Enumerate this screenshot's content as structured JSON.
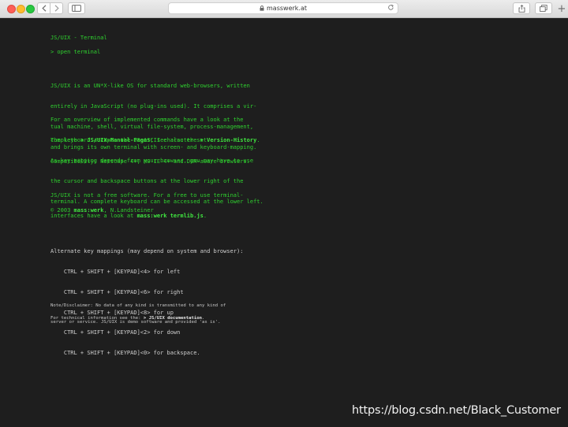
{
  "browser": {
    "url": "masswerk.at",
    "colors": {
      "red": "#fd5f57",
      "yellow": "#febc2e",
      "green": "#28c840"
    },
    "icons": [
      "back-arrow-icon",
      "forward-arrow-icon",
      "sidebar-icon",
      "lock-icon",
      "reload-icon",
      "share-icon",
      "tabs-icon",
      "plus-icon"
    ]
  },
  "terminal": {
    "text_color": "#2fd12f",
    "title": "JS/UIX - Terminal",
    "prompt": "> open terminal",
    "intro": [
      "JS/UIX is an UN*X-like OS for standard web-browsers, written",
      "entirely in JavaScript (no plug-ins used). It comprises a vir-",
      "tual machine, shell, virtual file-system, process-management,",
      "and brings its own terminal with screen- and keyboard-mapping."
    ],
    "overview": {
      "line1": "For an overview of implemented commands have a look at the",
      "line2_pre": "complete ",
      "manual_link": "> JS/UIX-Manual-Pages",
      "line2_mid": "; see also the ",
      "version_link": "> Version-History",
      "line2_post": "."
    },
    "keyboard": [
      "The keyboard accepts the US-ASCII character set.",
      "As key-mapping depends from your browser, you may have to use",
      "the cursor and backspace buttons at the lower right of the",
      "terminal. A complete keyboard can be accessed at the lower left."
    ],
    "compat": "Compatibility: Netscape 4+, MS IE 4+ and DOM-aware browsers.",
    "free": {
      "line1": "JS/UIX is not a free software. For a free to use terminal-",
      "line2_pre": "interfaces have a look at ",
      "link": "mass:werk termlib.js",
      "line2_post": "."
    },
    "copyright": {
      "pre": "© 2003 ",
      "link": "mass:werk",
      "post": ", N.Landsteiner"
    },
    "keymap_title": "Alternate key mappings (may depend on system and browser):",
    "keymap": [
      "    CTRL + SHIFT + [KEYPAD]<4> for left",
      "    CTRL + SHIFT + [KEYPAD]<6> for right",
      "    CTRL + SHIFT + [KEYPAD]<8> for up",
      "    CTRL + SHIFT + [KEYPAD]<2> for down",
      "    CTRL + SHIFT + [KEYPAD]<0> for backspace."
    ],
    "disclaimer": [
      "Note/Disclaimer: No data of any kind is transmitted to any kind of",
      "server or service. JS/UIX is demo software and provided 'as is'."
    ],
    "tech": {
      "pre": "For technical information see the: ",
      "link": "> JS/UIX documentation",
      "post": "."
    }
  },
  "watermark": "https://blog.csdn.net/Black_Customer"
}
